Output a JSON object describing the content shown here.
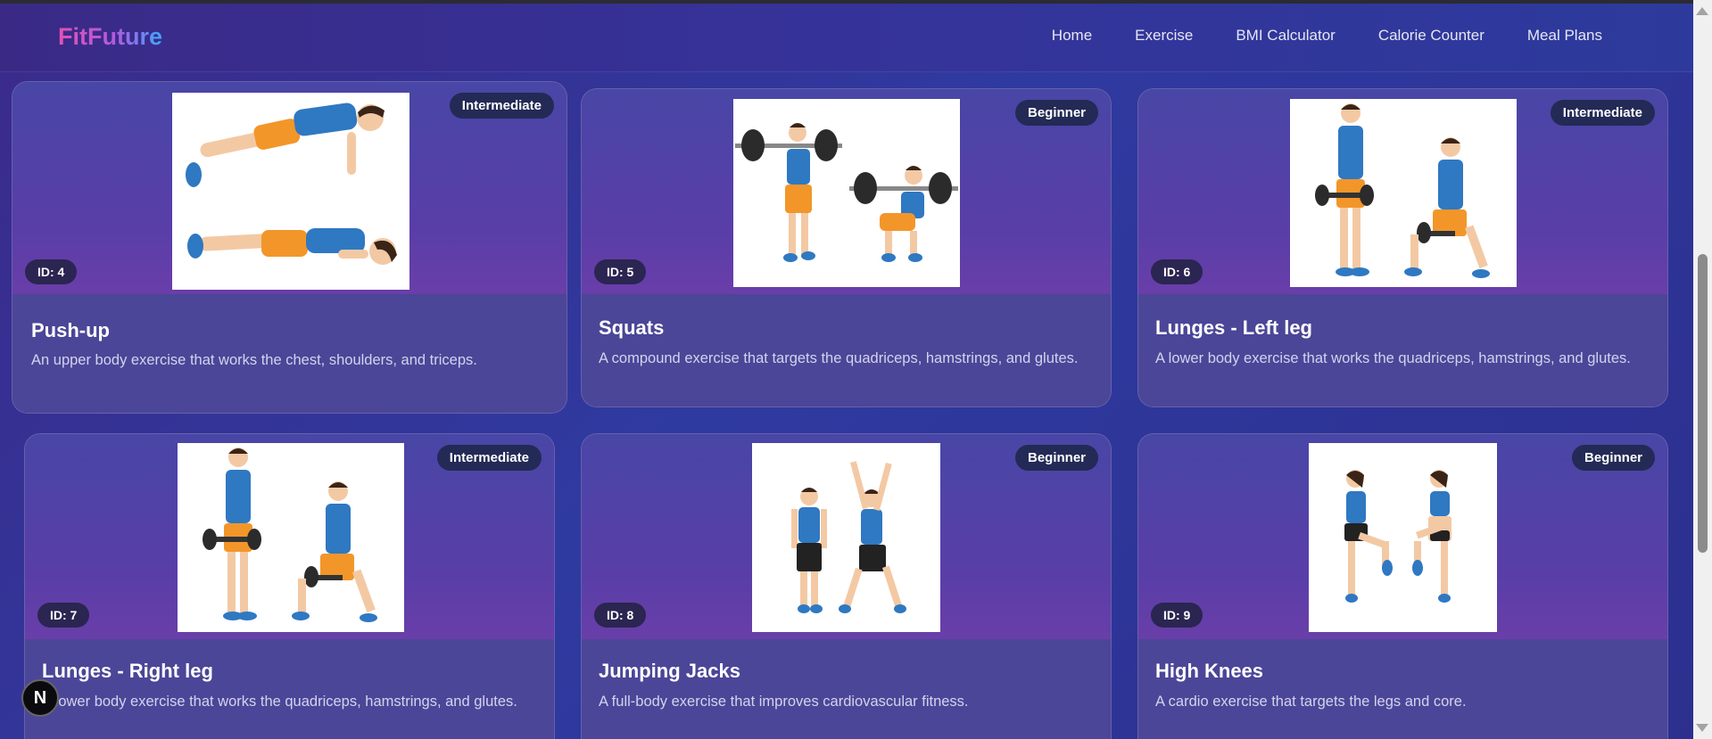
{
  "app": {
    "logo": "FitFuture"
  },
  "nav": [
    "Home",
    "Exercise",
    "BMI Calculator",
    "Calorie Counter",
    "Meal Plans"
  ],
  "cards": [
    {
      "id_label": "ID: 4",
      "level": "Intermediate",
      "title": "Push-up",
      "description": "An upper body exercise that works the chest, shoulders, and triceps.",
      "illustration": "push-up"
    },
    {
      "id_label": "ID: 5",
      "level": "Beginner",
      "title": "Squats",
      "description": "A compound exercise that targets the quadriceps, hamstrings, and glutes.",
      "illustration": "squats"
    },
    {
      "id_label": "ID: 6",
      "level": "Intermediate",
      "title": "Lunges - Left leg",
      "description": "A lower body exercise that works the quadriceps, hamstrings, and glutes.",
      "illustration": "lunges"
    },
    {
      "id_label": "ID: 7",
      "level": "Intermediate",
      "title": "Lunges - Right leg",
      "description": "A lower body exercise that works the quadriceps, hamstrings, and glutes.",
      "illustration": "lunges"
    },
    {
      "id_label": "ID: 8",
      "level": "Beginner",
      "title": "Jumping Jacks",
      "description": "A full-body exercise that improves cardiovascular fitness.",
      "illustration": "jumping-jacks"
    },
    {
      "id_label": "ID: 9",
      "level": "Beginner",
      "title": "High Knees",
      "description": "A cardio exercise that targets the legs and core.",
      "illustration": "high-knees"
    }
  ],
  "floating_button": {
    "label": "N"
  },
  "colors": {
    "background": "#2f3aa0",
    "badge": "#232a55",
    "card_top": "#5a3ea8",
    "shirt": "#2f78c2",
    "shorts": "#f2962a"
  }
}
